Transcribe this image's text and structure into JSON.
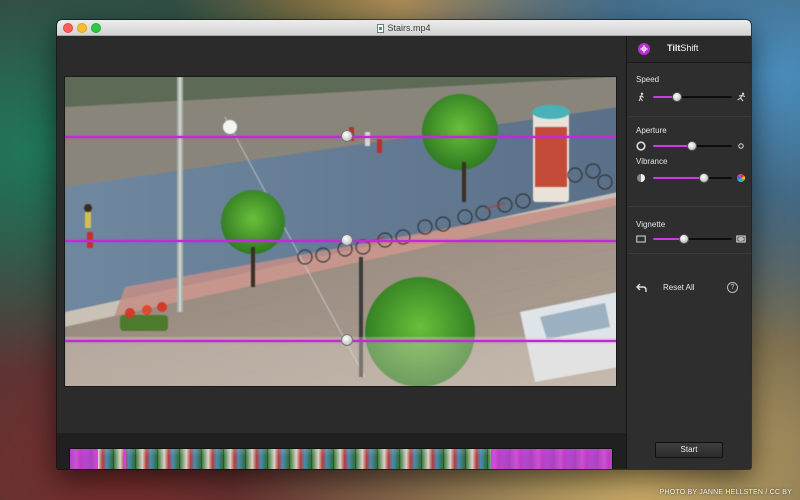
{
  "window": {
    "title": "Stairs.mp4"
  },
  "panel": {
    "brand_bold": "Tilt",
    "brand_rest": "Shift",
    "speed": {
      "label": "Speed",
      "value": 0.31
    },
    "aperture": {
      "label": "Aperture",
      "value": 0.49
    },
    "vibrance": {
      "label": "Vibrance",
      "value": 0.64
    },
    "vignette": {
      "label": "Vignette",
      "value": 0.39
    },
    "reset_label": "Reset All",
    "help_label": "?",
    "start_label": "Start",
    "accent_color": "#c93ee0"
  },
  "video": {
    "guide_color": "#c02ad8"
  },
  "timeline": {
    "selection_start": 0.05,
    "selection_end": 0.775,
    "selection_color": "#c43cd6"
  },
  "credit": "PHOTO BY JANNE HELLSTEN / CC BY",
  "icons": [
    "walk-icon",
    "run-icon",
    "aperture-small-icon",
    "aperture-large-icon",
    "vibrance-low-icon",
    "vibrance-high-icon",
    "vignette-none-icon",
    "vignette-full-icon",
    "undo-arrow-icon",
    "help-icon",
    "tiltshift-logo-icon"
  ]
}
